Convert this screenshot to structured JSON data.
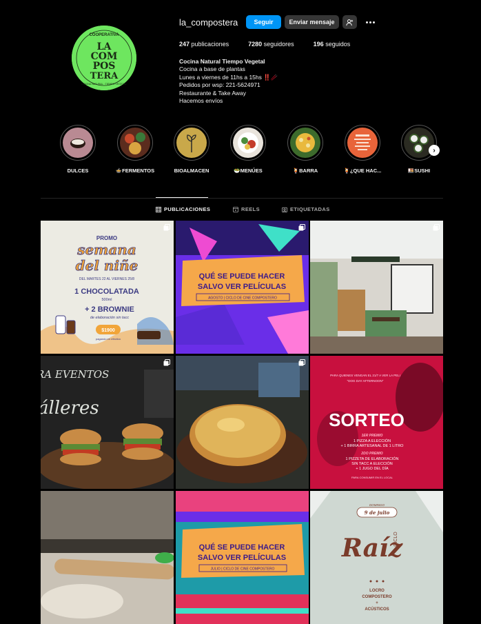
{
  "profile": {
    "username": "la_compostera",
    "follow_label": "Seguir",
    "message_label": "Enviar mensaje",
    "avatar_text": [
      "COOPERATIVA",
      "LA",
      "COM",
      "POS",
      "TERA",
      "COCINA NATURAL · TIEMPO VEGETAL"
    ],
    "avatar_color": "#6ee65f"
  },
  "stats": {
    "posts_count": "247",
    "posts_label": "publicaciones",
    "followers_count": "7280",
    "followers_label": "seguidores",
    "following_count": "196",
    "following_label": "seguidos"
  },
  "bio": {
    "name": "Cocina Natural Tiempo Vegetal",
    "lines": [
      "Cocina a base de plantas",
      "Lunes a viernes de 11hs a 15hs ‼️🥢",
      "Pedidos por wsp: 221-5624971",
      "Restaurante & Take Away",
      "Hacemos envíos"
    ]
  },
  "highlights": [
    {
      "label": "DULCES"
    },
    {
      "label": "🍲FERMENTOS"
    },
    {
      "label": "BIOALMACEN"
    },
    {
      "label": "🥗MENÚES"
    },
    {
      "label": "🍹BARRA"
    },
    {
      "label": "🍹¿QUE HAC..."
    },
    {
      "label": "🍱SUSHI"
    }
  ],
  "tabs": [
    {
      "label": "PUBLICACIONES"
    },
    {
      "label": "REELS"
    },
    {
      "label": "ETIQUETADAS"
    }
  ],
  "posts": {
    "p1": {
      "promo": "PROMO",
      "line1": "semana",
      "line2": "del niñe",
      "dates": "DEL MARTES 22 AL VIERNES 25/8",
      "item1": "1 CHOCOLATADA",
      "item1_sub": "500ml",
      "item2": "+ 2 BROWNIE",
      "item2_sub": "de elaboración sin tacc",
      "price": "$1900",
      "price_note": "pagando en efectivo"
    },
    "p2": {
      "line1": "QUÉ SE PUEDE HACER",
      "line2": "SALVO VER PELÍCULAS",
      "footer": "AGOSTO | CICLO DE CINE COMPOSTERO"
    },
    "p4": {
      "line1": "RA EVENTOS",
      "line2": "álleres"
    },
    "p6": {
      "top": "PARA QUIENES VENGAN EL 21/7 A VER LA PELI",
      "film": "\"DOG DAY AFTERNOON\"",
      "title": "SORTEO",
      "prize1_head": "1ER PREMIO",
      "prize1_a": "1 PIZZA A ELECCIÓN",
      "prize1_b": "+ 1 BIRRA ARTESANAL DE 1 LITRO",
      "prize2_head": "2DO PREMIO",
      "prize2_a": "1 PIZZETA DE ELABORACIÓN",
      "prize2_b": "SIN TACC A ELECCIÓN",
      "prize2_c": "+ 1 JUGO DEL DÍA",
      "foot": "PARA CONSUMIR EN EL LOCAL"
    },
    "p8": {
      "line1": "QUÉ SE PUEDE HACER",
      "line2": "SALVO VER PELÍCULAS",
      "footer": "JULIO | CICLO DE CINE COMPOSTERO"
    },
    "p9": {
      "day": "DOMINGO",
      "date": "9 de julio",
      "ciclo": "CICLO",
      "title": "Raíz",
      "line1": "LOCRO",
      "line2": "COMPOSTERO",
      "line3": "+",
      "line4": "ACÚSTICOS"
    }
  }
}
